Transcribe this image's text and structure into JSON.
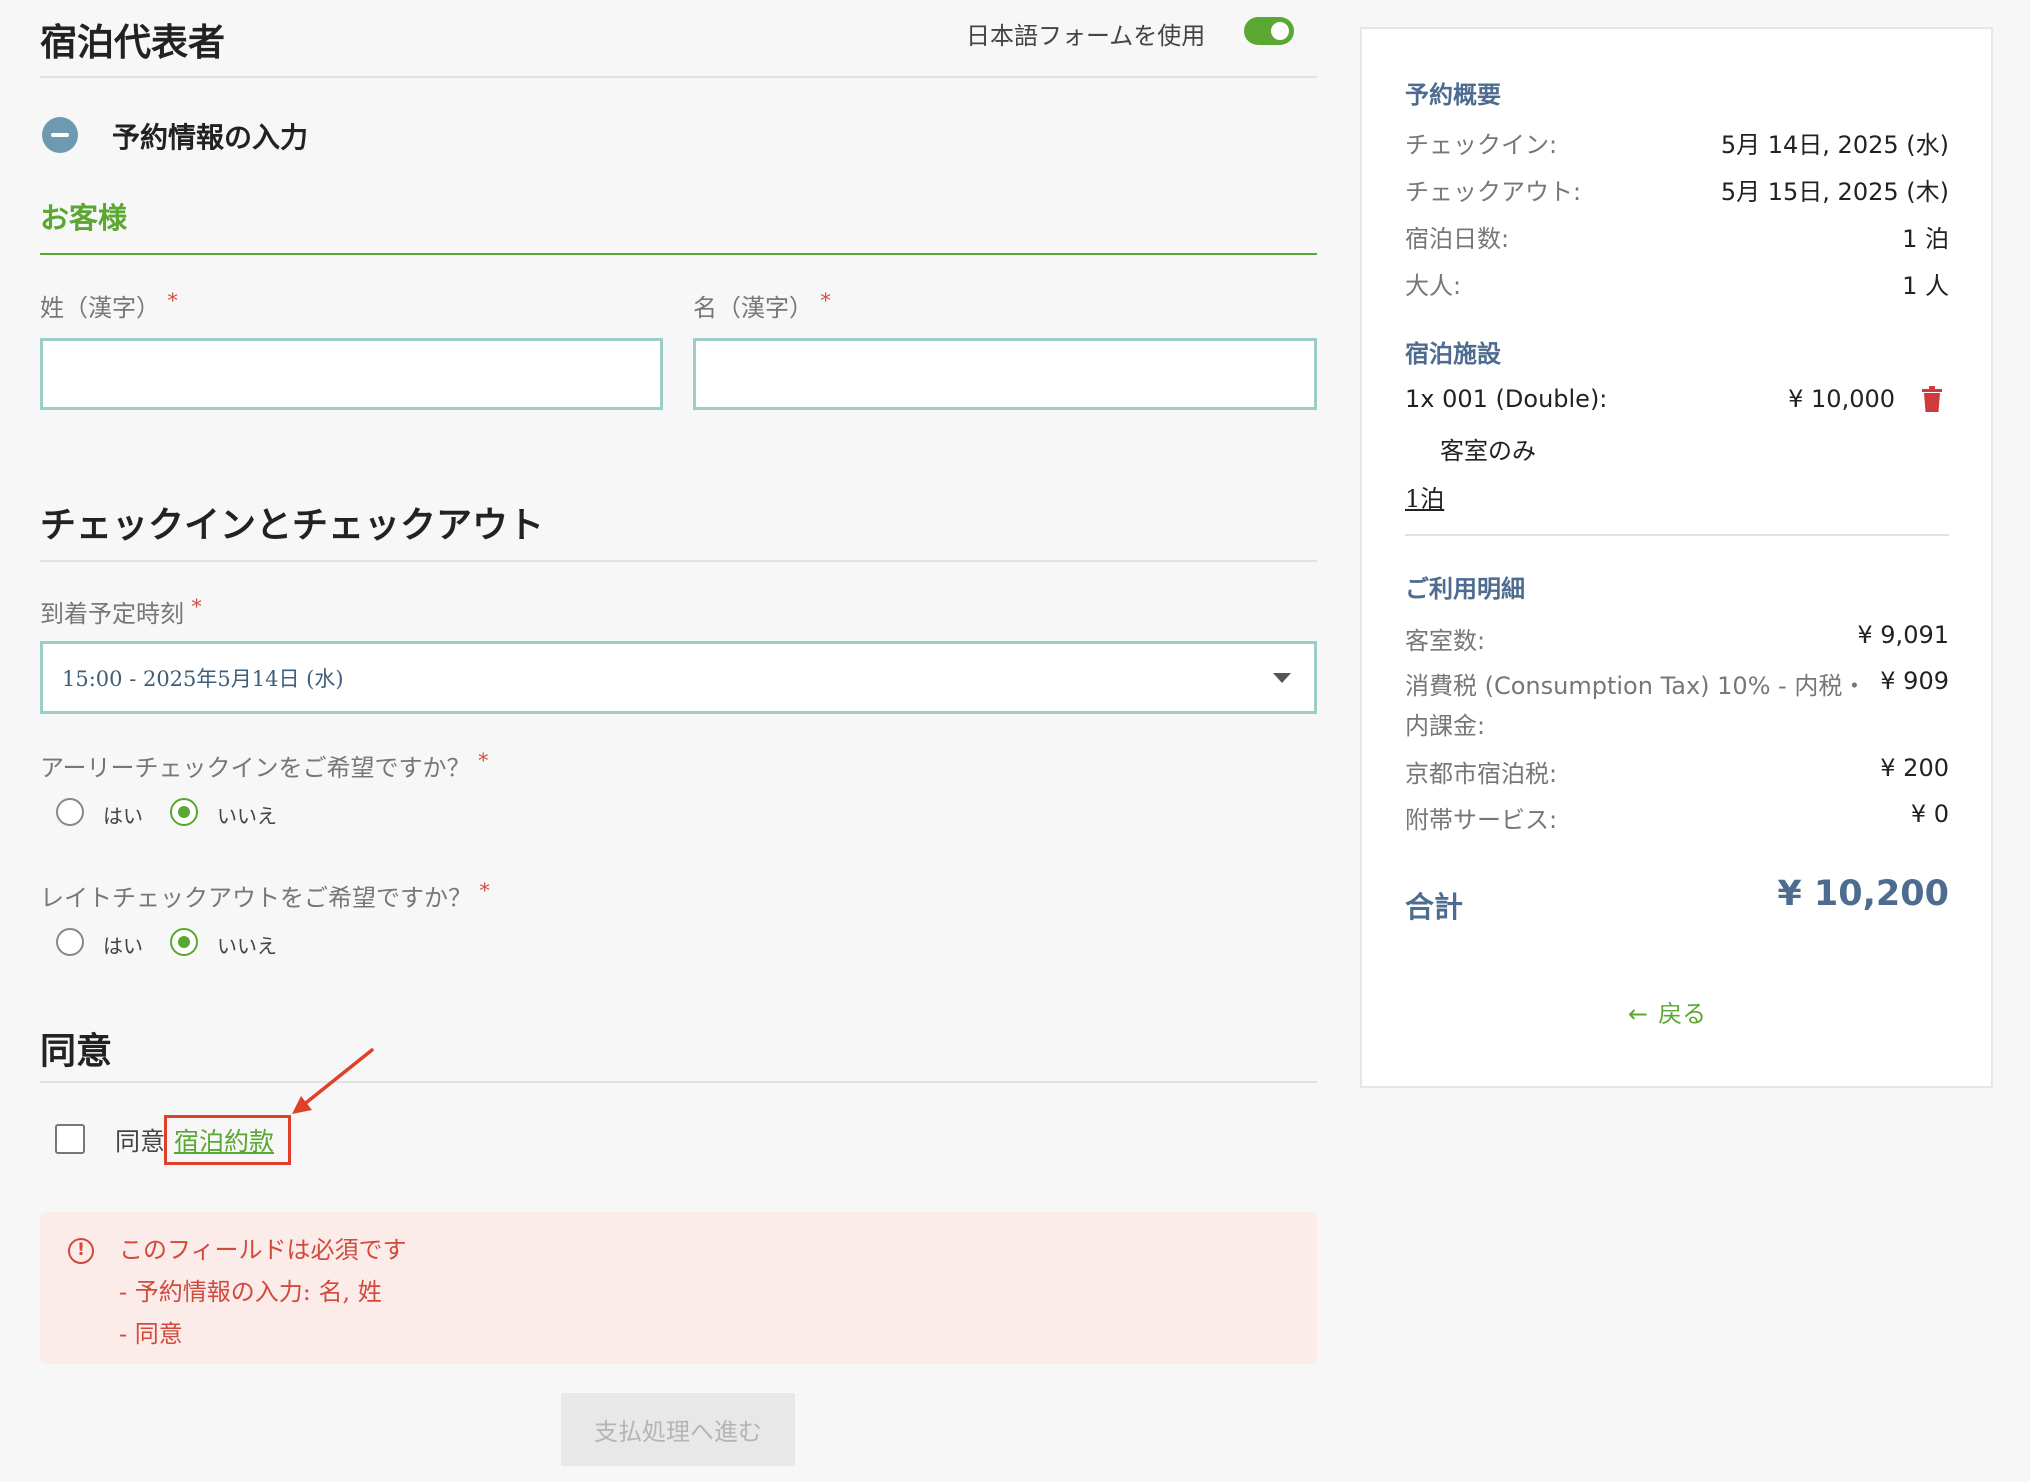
{
  "header": {
    "title": "宿泊代表者",
    "toggle_label": "日本語フォームを使用",
    "toggle_on": true
  },
  "reservation_section": {
    "title": "予約情報の入力",
    "guest_heading": "お客様",
    "last_name_label": "姓（漢字）",
    "first_name_label": "名（漢字）",
    "required_mark": "*",
    "last_name_value": "",
    "first_name_value": ""
  },
  "checkin_section": {
    "title": "チェックインとチェックアウト",
    "arrival_label": "到着予定時刻",
    "arrival_value": "15:00 - 2025年5月14日 (水)",
    "early_checkin_question": "アーリーチェックインをご希望ですか？",
    "late_checkout_question": "レイトチェックアウトをご希望ですか？",
    "yes": "はい",
    "no": "いいえ",
    "early_checkin_selected": "いいえ",
    "late_checkout_selected": "いいえ"
  },
  "consent_section": {
    "title": "同意",
    "consent_text": "同意",
    "terms_link": "宿泊約款",
    "checked": false
  },
  "errors": {
    "icon": "exclamation-circle-icon",
    "heading": "このフィールドは必須です",
    "items": [
      "- 予約情報の入力: 名, 姓",
      "- 同意"
    ]
  },
  "submit_label": "支払処理へ進む",
  "summary": {
    "title": "予約概要",
    "rows": [
      {
        "label": "チェックイン:",
        "value": "5月 14日, 2025 (水)"
      },
      {
        "label": "チェックアウト:",
        "value": "5月 15日, 2025 (木)"
      },
      {
        "label": "宿泊日数:",
        "value": "1 泊"
      },
      {
        "label": "大人:",
        "value": "1 人"
      }
    ],
    "facility_title": "宿泊施設",
    "room_label": "1x 001 (Double):",
    "room_price": "¥ 10,000",
    "room_plan": "客室のみ",
    "nights_link": "1泊",
    "details_title": "ご利用明細",
    "detail_rows": [
      {
        "label": "客室数:",
        "value": "¥ 9,091"
      },
      {
        "label": "消費税 (Consumption Tax) 10% - 内税・内課金:",
        "value": "¥ 909"
      },
      {
        "label": "京都市宿泊税:",
        "value": "¥ 200"
      },
      {
        "label": "附帯サービス:",
        "value": "¥ 0"
      }
    ],
    "total_label": "合計",
    "total_value": "¥ 10,200",
    "back_label": "戻る"
  },
  "colors": {
    "accent_green": "#5aa732",
    "heading_blue": "#4d6c90",
    "error_red": "#d24a3c",
    "input_border": "#9ccec8"
  }
}
